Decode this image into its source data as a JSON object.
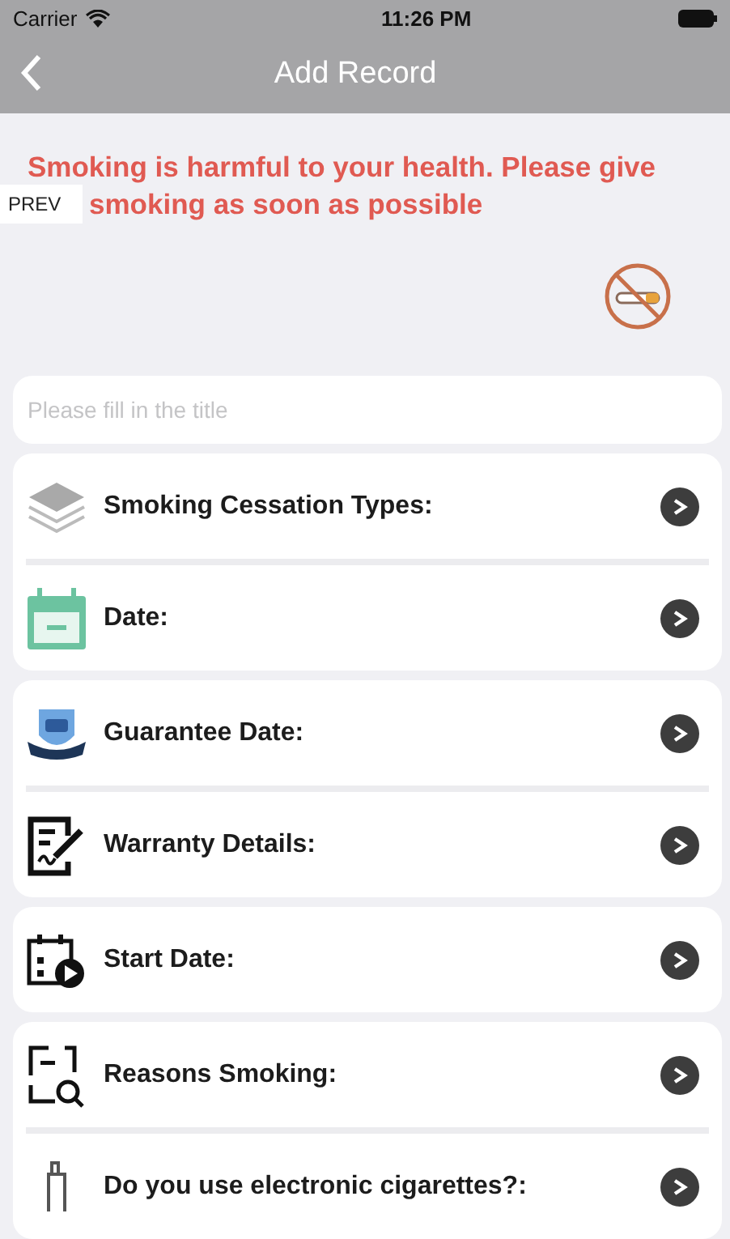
{
  "status_bar": {
    "carrier": "Carrier",
    "time": "11:26 PM"
  },
  "nav_bar": {
    "title": "Add Record"
  },
  "warning": {
    "lines": [
      "Smoking is harmful to your health. Please give",
      "smoking as soon as possible"
    ],
    "overlay_label": "PREV"
  },
  "title_field": {
    "placeholder": "Please fill in the title"
  },
  "cards": [
    {
      "rows": [
        {
          "label": "Smoking Cessation Types:"
        },
        {
          "label": "Date:"
        }
      ]
    },
    {
      "rows": [
        {
          "label": "Guarantee Date:"
        },
        {
          "label": "Warranty Details:"
        }
      ]
    },
    {
      "rows": [
        {
          "label": "Start Date:"
        }
      ]
    },
    {
      "rows": [
        {
          "label": "Reasons Smoking:"
        },
        {
          "label": "Do you use electronic cigarettes?:"
        }
      ]
    }
  ]
}
